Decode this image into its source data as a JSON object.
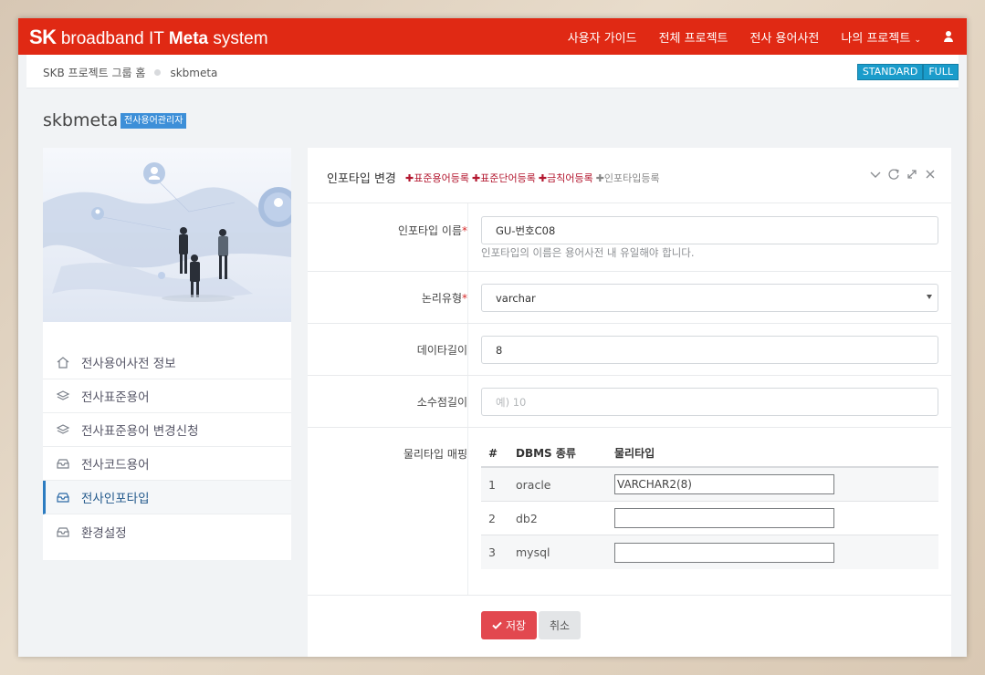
{
  "header": {
    "logo_sk": "SK",
    "logo_rest": " broadband IT ",
    "logo_meta": "Meta",
    "logo_system": " system",
    "nav": [
      "사용자 가이드",
      "전체 프로젝트",
      "전사 용어사전",
      "나의 프로젝트"
    ],
    "brand_color": "#e02914"
  },
  "breadcrumb": {
    "home": "SKB 프로젝트 그룹 홈",
    "current": "skbmeta"
  },
  "modes": [
    "STANDARD",
    "FULL"
  ],
  "page": {
    "title": "skbmeta",
    "role_badge": "전사용어관리자"
  },
  "sidebar": {
    "items": [
      {
        "label": "전사용어사전 정보",
        "icon": "home-icon"
      },
      {
        "label": "전사표준용어",
        "icon": "layers-icon"
      },
      {
        "label": "전사표준용어 변경신청",
        "icon": "layers-icon"
      },
      {
        "label": "전사코드용어",
        "icon": "inbox-icon"
      },
      {
        "label": "전사인포타입",
        "icon": "inbox-icon",
        "active": true
      },
      {
        "label": "환경설정",
        "icon": "inbox-icon"
      }
    ]
  },
  "panel": {
    "title": "인포타입 변경",
    "links": [
      "✚표준용어등록",
      "✚표준단어등록",
      "✚금칙어등록",
      "✚인포타입등록"
    ],
    "form": {
      "name_label": "인포타입 이름",
      "name_value": "GU-번호C08",
      "name_help": "인포타입의 이름은 용어사전 내 유일해야 합니다.",
      "type_label": "논리유형",
      "type_value": "varchar",
      "length_label": "데이타길이",
      "length_value": "8",
      "scale_label": "소수점길이",
      "scale_placeholder": "예) 10",
      "mapping_label": "물리타입 매핑"
    },
    "mapping": {
      "headers": [
        "#",
        "DBMS 종류",
        "물리타입"
      ],
      "rows": [
        {
          "num": "1",
          "dbms": "oracle",
          "type": "VARCHAR2(8)"
        },
        {
          "num": "2",
          "dbms": "db2",
          "type": ""
        },
        {
          "num": "3",
          "dbms": "mysql",
          "type": ""
        }
      ]
    },
    "save_label": "저장",
    "cancel_label": "취소"
  }
}
